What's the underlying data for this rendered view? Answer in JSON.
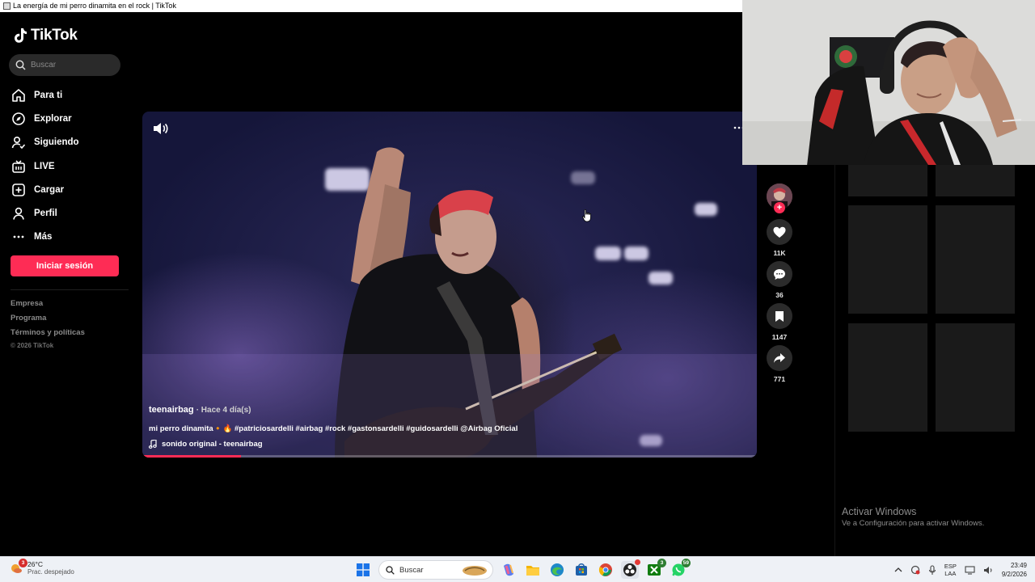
{
  "window": {
    "title": "La energía de mi perro dinamita en el rock | TikTok"
  },
  "sidebar": {
    "logo_text": "TikTok",
    "search_placeholder": "Buscar",
    "nav": [
      {
        "label": "Para ti",
        "icon": "home-icon"
      },
      {
        "label": "Explorar",
        "icon": "compass-icon"
      },
      {
        "label": "Siguiendo",
        "icon": "following-icon"
      },
      {
        "label": "LIVE",
        "icon": "live-icon"
      },
      {
        "label": "Cargar",
        "icon": "upload-icon"
      },
      {
        "label": "Perfil",
        "icon": "profile-icon"
      },
      {
        "label": "Más",
        "icon": "more-icon"
      }
    ],
    "login_label": "Iniciar sesión",
    "footer_links": [
      "Empresa",
      "Programa",
      "Términos y políticas"
    ],
    "copyright": "© 2026 TikTok"
  },
  "video": {
    "author": "teenairbag",
    "time_ago": "· Hace 4 día(s)",
    "caption": "mi perro dinamita🔸🔥 #patriciosardelli #airbag #rock #gastonsardelli #guidosardelli @Airbag Oficial",
    "sound": "sonido original - teenairbag",
    "progress_fraction": 0.16
  },
  "actions": {
    "likes": "11K",
    "comments": "36",
    "saves": "1147",
    "shares": "771",
    "follow_label": "+"
  },
  "watermark": {
    "line1": "Activar Windows",
    "line2": "Ve a Configuración para activar Windows."
  },
  "taskbar": {
    "weather_temp": "26°C",
    "weather_desc": "Prac. despejado",
    "weather_badge": "3",
    "search_label": "Buscar",
    "xbox_badge": "3",
    "whatsapp_badge": "59",
    "lang_top": "ESP",
    "lang_bottom": "LAA",
    "time": "23:49",
    "date": "9/2/2026"
  }
}
